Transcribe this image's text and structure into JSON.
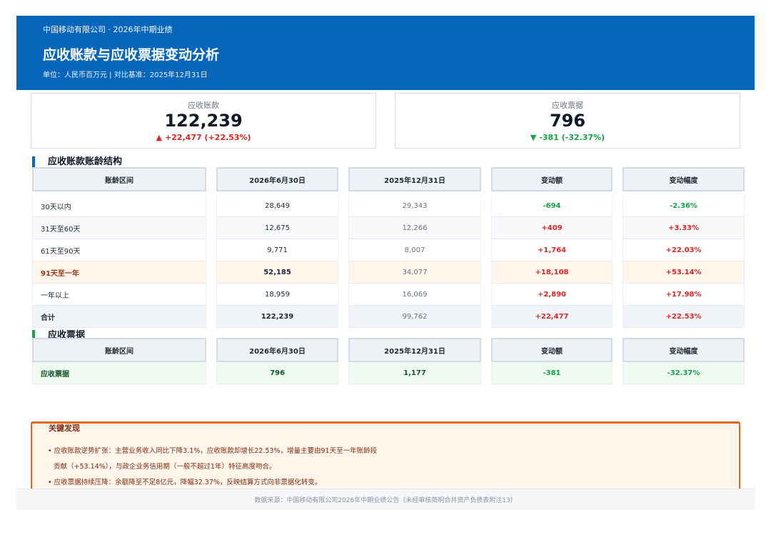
{
  "header": {
    "crumb": "中国移动有限公司 · 2026年中期业绩",
    "title": "应收账款与应收票据变动分析",
    "unit": "单位：人民币百万元 | 对比基准：2025年12月31日"
  },
  "kpis": {
    "receivables": {
      "label": "应收账款",
      "value": "122,239",
      "arrow": "▲",
      "delta": "+22,477 (+22.53%)"
    },
    "notes": {
      "label": "应收票据",
      "value": "796",
      "arrow": "▼",
      "delta": "-381 (-32.37%)"
    }
  },
  "aging": {
    "title": "应收账款账龄结构",
    "headers": [
      "账龄区间",
      "2026年6月30日",
      "2025年12月31日",
      "变动额",
      "变动幅度"
    ],
    "rows": [
      [
        "30天以内",
        "28,649",
        "29,343",
        "-694",
        "-2.36%"
      ],
      [
        "31天至60天",
        "12,675",
        "12,266",
        "+409",
        "+3.33%"
      ],
      [
        "61天至90天",
        "9,771",
        "8,007",
        "+1,764",
        "+22.03%"
      ],
      [
        "91天至一年",
        "52,185",
        "34,077",
        "+18,108",
        "+53.14%"
      ],
      [
        "一年以上",
        "18,959",
        "16,069",
        "+2,890",
        "+17.98%"
      ],
      [
        "合计",
        "122,239",
        "99,762",
        "+22,477",
        "+22.53%"
      ]
    ]
  },
  "bills": {
    "title": "应收票据",
    "headers": [
      "账龄区间",
      "2026年6月30日",
      "2025年12月31日",
      "变动额",
      "变动幅度"
    ],
    "rows": [
      [
        "应收票据",
        "796",
        "1,177",
        "-381",
        "-32.37%"
      ]
    ]
  },
  "findings": {
    "title": "关键发现",
    "lines": [
      "• 应收账款逆势扩张：主营业务收入同比下降3.1%，应收账款却增长22.53%，增量主要由91天至一年账龄段",
      "贡献（+53.14%），与政企业务信用期（一般不超过1年）特征高度吻合。",
      "• 应收票据持续压降：余额降至不足8亿元，降幅32.37%，反映结算方式向非票据化转变。"
    ]
  },
  "footer": {
    "source": "数据来源：中国移动有限公司2026年中期业绩公告（未经审核简明合并资产负债表附注13）"
  },
  "colors": {
    "header_bg": "#0766b9",
    "increase": "#dc2626",
    "decrease": "#16a34a",
    "aging_accent": "#0766b9",
    "bills_accent": "#16a34a",
    "findings_border": "#e5661f"
  }
}
